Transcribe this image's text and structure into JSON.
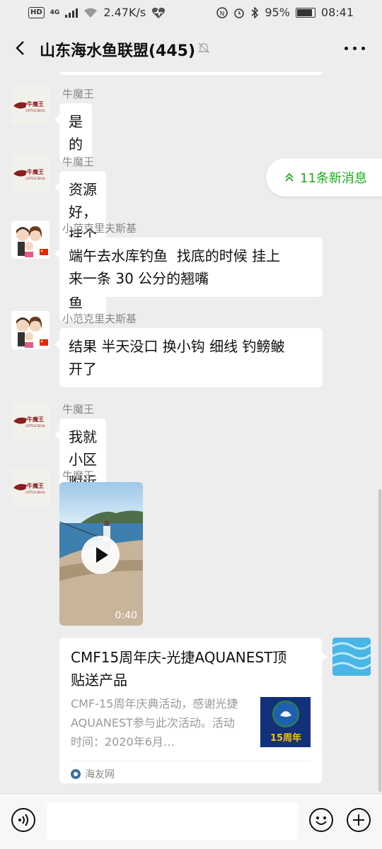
{
  "status_bar": {
    "hd": "HD",
    "network": "4G",
    "speed": "2.47K/s",
    "battery": "95%",
    "battery_level": 0.95,
    "time": "08:41"
  },
  "header": {
    "title": "山东海水鱼联盟(445)"
  },
  "new_messages": {
    "label": "11条新消息"
  },
  "messages": [
    {
      "sender": "牛魔王",
      "avatar": "cattle-devil-logo",
      "text": "是的"
    },
    {
      "sender": "牛魔王",
      "avatar": "cattle-devil-logo",
      "text": "资源好，挂个烟把都上鱼"
    },
    {
      "sender": "小范克里夫斯基",
      "avatar": "couple-cartoon",
      "text": "端午去水库钓鱼  找底的时候 挂上\n来一条 30 公分的翘嘴"
    },
    {
      "sender": "小范克里夫斯基",
      "avatar": "couple-cartoon",
      "text": "结果 半天没口 换小钩 细线 钓鳑鲏\n开了"
    },
    {
      "sender": "牛魔王",
      "avatar": "cattle-devil-logo",
      "text": "我就小区附近路白条，小奶鲈"
    },
    {
      "sender": "牛魔王",
      "avatar": "cattle-devil-logo",
      "video_duration": "0:40"
    }
  ],
  "avatar_logo": {
    "line1": "牛魔王",
    "line2": "CATTLE DEVIL"
  },
  "link_card": {
    "title": "CMF15周年庆-光捷AQUANEST顶\n贴送产品",
    "description": "CMF-15周年庆典活动，感谢光捷AQUANEST参与此次活动。活动时间：2020年6月…",
    "thumb_text": "15周年",
    "source": "海友网"
  },
  "colors": {
    "accent_green": "#1aad19",
    "background": "#ededed",
    "bubble": "#ffffff"
  }
}
